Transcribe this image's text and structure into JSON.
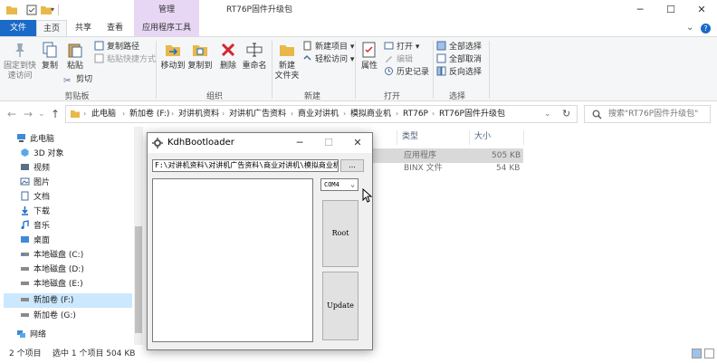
{
  "window": {
    "tool_tab": "管理",
    "title": "RT76P固件升级包",
    "min": "─",
    "max": "☐",
    "close": "✕"
  },
  "ribbon_tabs": {
    "file": "文件",
    "home": "主页",
    "share": "共享",
    "view": "查看",
    "app_tools": "应用程序工具",
    "collapse": "⌄",
    "help": "?"
  },
  "ribbon": {
    "clipboard": {
      "pin": "固定到快\n速访问",
      "copy": "复制",
      "paste": "粘贴",
      "copy_path": "复制路径",
      "paste_shortcut": "粘贴快捷方式",
      "cut": "剪切",
      "label": "剪贴板"
    },
    "organize": {
      "move_to": "移动到",
      "copy_to": "复制到",
      "delete": "删除",
      "rename": "重命名",
      "label": "组织"
    },
    "new": {
      "new_folder": "新建\n文件夹",
      "new_item": "新建项目 ▾",
      "easy_access": "轻松访问 ▾",
      "label": "新建"
    },
    "open": {
      "properties": "属性",
      "open": "打开 ▾",
      "edit": "编辑",
      "history": "历史记录",
      "label": "打开"
    },
    "select": {
      "select_all": "全部选择",
      "select_none": "全部取消",
      "invert": "反向选择",
      "label": "选择"
    }
  },
  "address": {
    "back": "←",
    "forward": "→",
    "recent": "⌄",
    "up": "↑",
    "crumbs": [
      "此电脑",
      "新加卷 (F:)",
      "对讲机资料",
      "对讲机广告资料",
      "商业对讲机",
      "模拟商业机",
      "RT76P",
      "RT76P固件升级包"
    ],
    "separator": "›",
    "dropdown": "⌄",
    "refresh": "↻",
    "search_placeholder": "搜索\"RT76P固件升级包\""
  },
  "nav": {
    "items": [
      "此电脑",
      "3D 对象",
      "视频",
      "图片",
      "文档",
      "下载",
      "音乐",
      "桌面",
      "本地磁盘 (C:)",
      "本地磁盘 (D:)",
      "本地磁盘 (E:)",
      "新加卷 (F:)",
      "新加卷 (G:)",
      "网络"
    ]
  },
  "files": {
    "columns": {
      "type": "类型",
      "size": "大小"
    },
    "rows": [
      {
        "type": "应用程序",
        "size": "505 KB"
      },
      {
        "type": "BINX 文件",
        "size": "54 KB"
      }
    ]
  },
  "status": {
    "count": "2 个项目",
    "selection": "选中 1 个项目  504 KB"
  },
  "dialog": {
    "title": "KdhBootloader",
    "min": "─",
    "max": "☐",
    "close": "✕",
    "path": "F:\\对讲机资料\\对讲机广告资料\\商业对讲机\\模拟商业机\\",
    "browse": "...",
    "com_port": "COM4",
    "com_arrow": "⌄",
    "root_button": "Root",
    "update_button": "Update"
  },
  "colors": {
    "accent": "#1a6ac8",
    "tool_tab": "#e7d7f4",
    "selection": "#cce8ff",
    "folder": "#e8b84a"
  }
}
